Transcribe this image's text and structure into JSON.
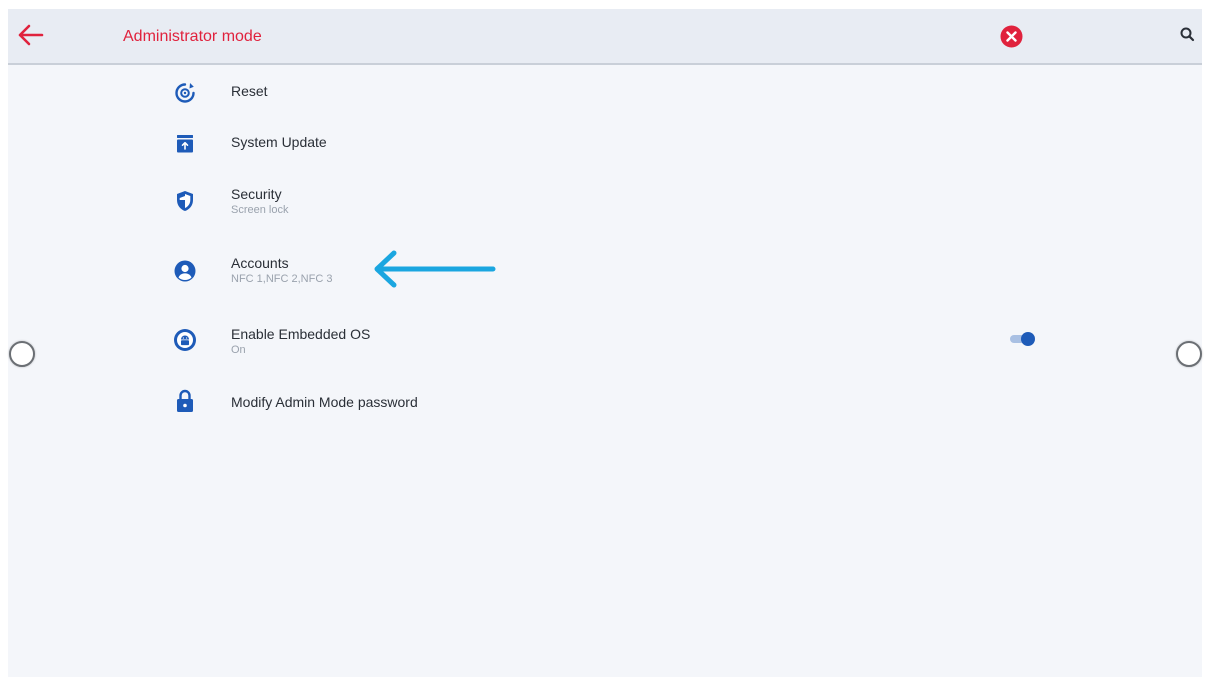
{
  "header": {
    "title": "Administrator mode",
    "back_icon": "arrow-left-icon",
    "close_icon": "close-circle-icon",
    "search_icon": "search-icon"
  },
  "menu": {
    "items": [
      {
        "label": "Reset",
        "sublabel": "",
        "icon": "reset-icon"
      },
      {
        "label": "System Update",
        "sublabel": "",
        "icon": "system-update-icon"
      },
      {
        "label": "Security",
        "sublabel": "Screen lock",
        "icon": "shield-icon"
      },
      {
        "label": "Accounts",
        "sublabel": "NFC 1,NFC 2,NFC 3",
        "icon": "account-icon"
      },
      {
        "label": "Enable Embedded OS",
        "sublabel": "On",
        "icon": "android-icon",
        "toggle_on": true
      },
      {
        "label": "Modify Admin Mode password",
        "sublabel": "",
        "icon": "lock-icon"
      }
    ]
  },
  "colors": {
    "accent_red": "#e0223d",
    "icon_blue": "#1e5bb8",
    "annotation_arrow": "#1aa6e0",
    "background": "#f4f6fa"
  }
}
